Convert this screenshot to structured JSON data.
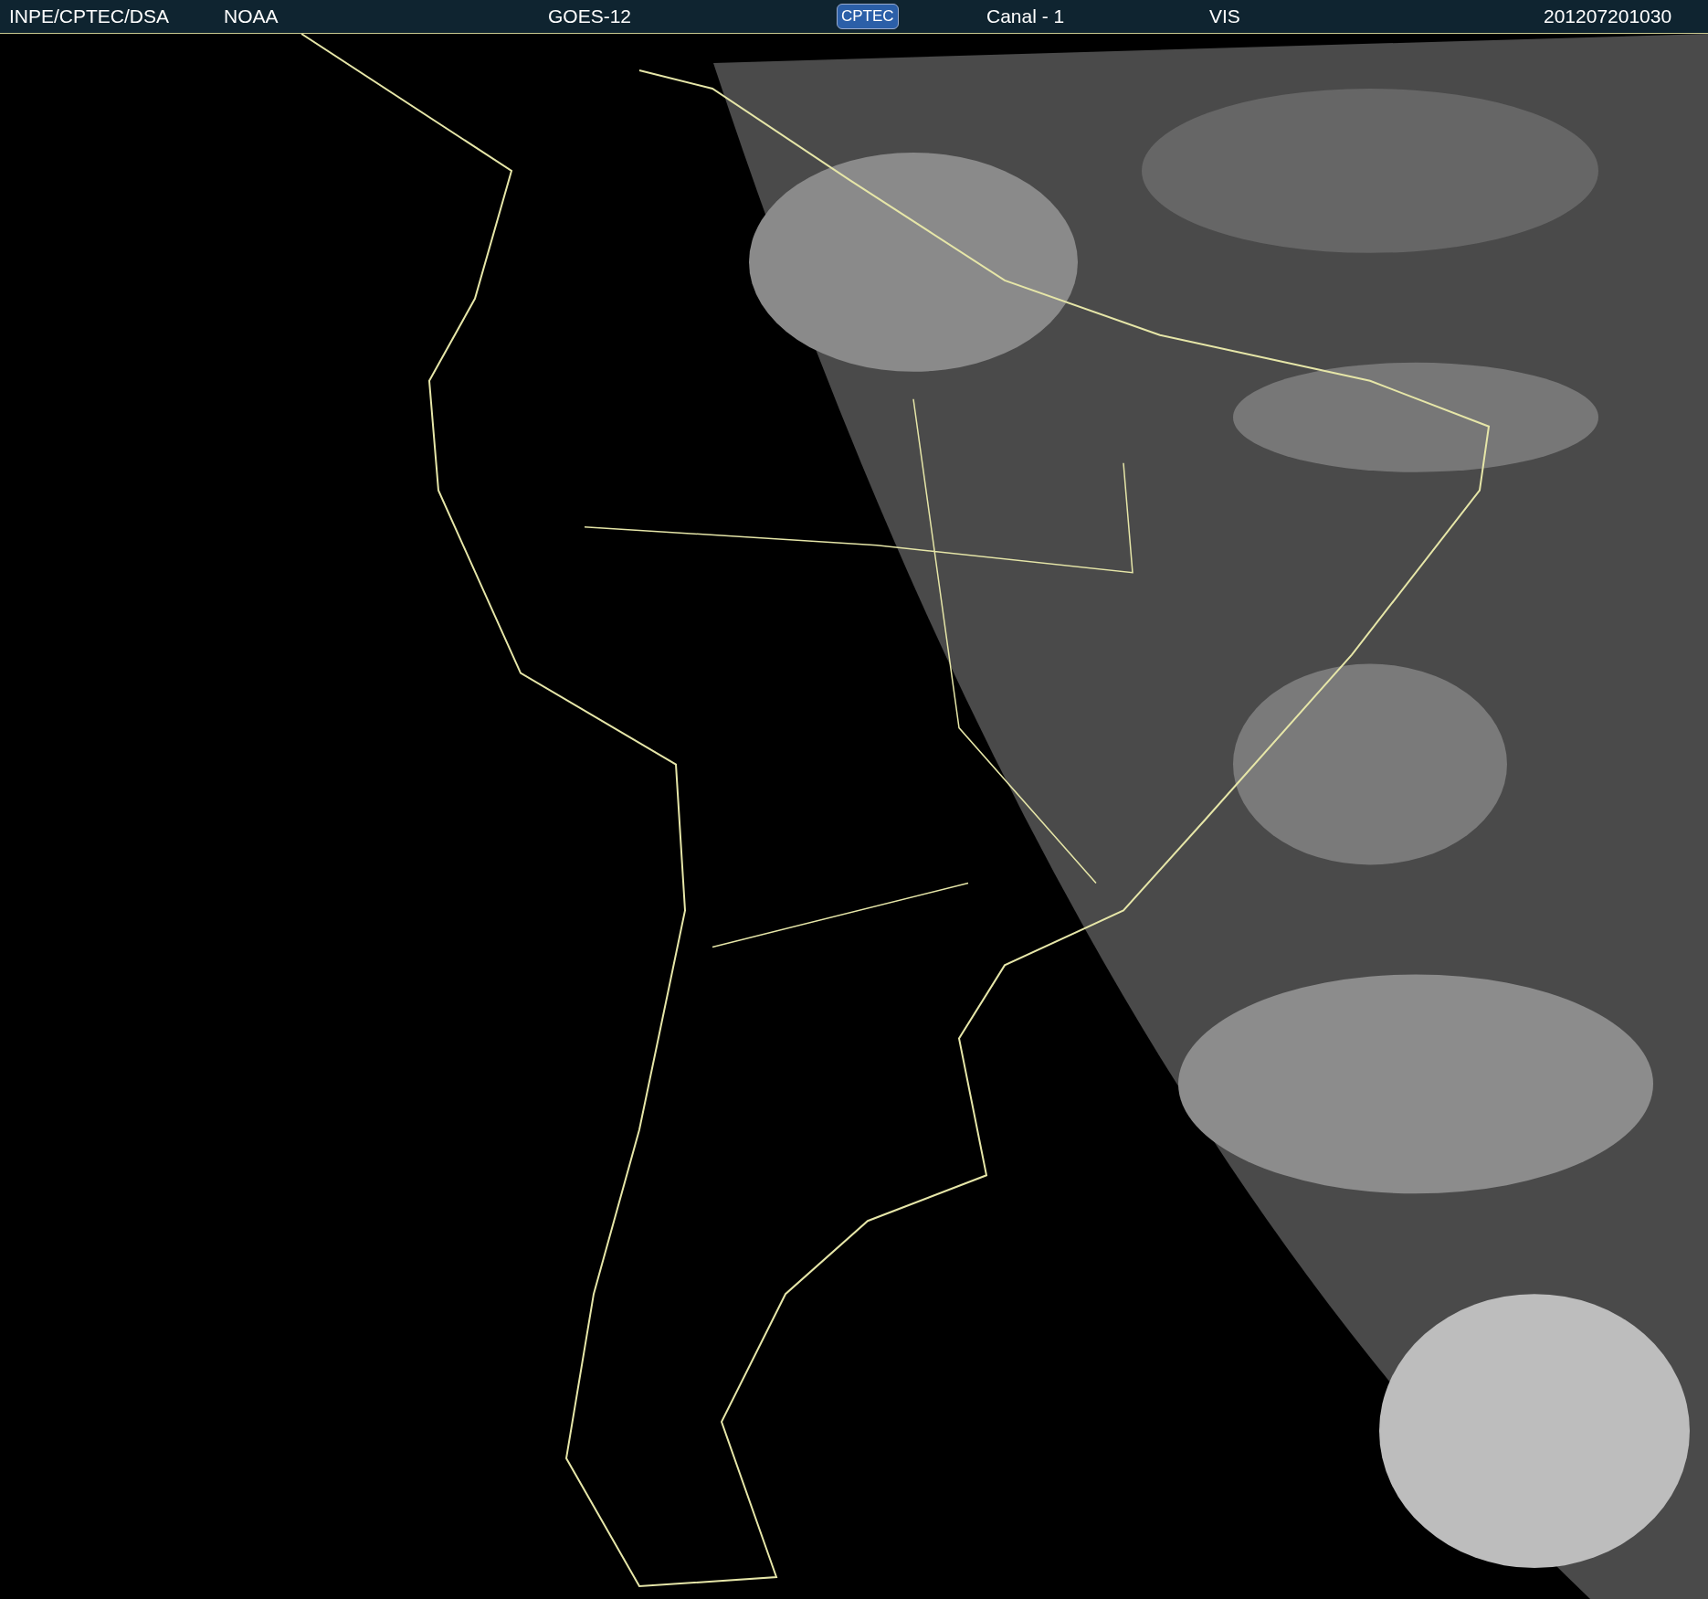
{
  "header": {
    "items": [
      {
        "kind": "text",
        "text": "INPE/CPTEC/DSA"
      },
      {
        "kind": "text",
        "text": "NOAA"
      },
      {
        "kind": "text",
        "text": "GOES-12"
      },
      {
        "kind": "logo",
        "text": "CPTEC"
      },
      {
        "kind": "text",
        "text": "Canal - 1"
      },
      {
        "kind": "text",
        "text": "VIS"
      },
      {
        "kind": "text",
        "text": "201207201030"
      }
    ]
  }
}
